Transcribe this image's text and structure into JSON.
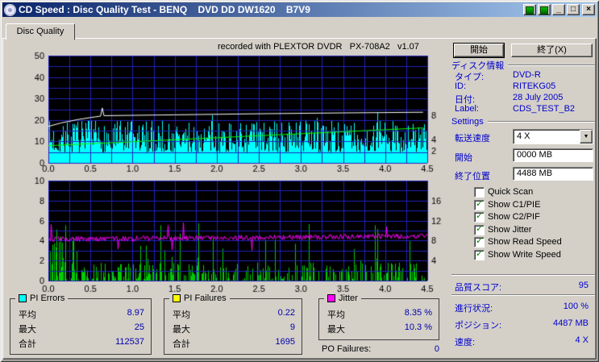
{
  "window": {
    "title": "CD Speed : Disc Quality Test - BENQ    DVD DD DW1620    B7V9",
    "minimize": "_",
    "maximize": "□",
    "close": "×"
  },
  "tab": {
    "label": "Disc Quality"
  },
  "recorded_note": "recorded with PLEXTOR DVDR   PX-708A2   v1.07",
  "right_panel": {
    "start_button": "開始",
    "exit_button": "終了(X)",
    "disc_info": {
      "header": "ディスク情報",
      "rows": [
        {
          "label": "タイプ:",
          "value": "DVD-R"
        },
        {
          "label": "ID:",
          "value": "RITEKG05"
        },
        {
          "label": "日付:",
          "value": "28 July 2005"
        },
        {
          "label": "Label:",
          "value": "CDS_TEST_B2"
        }
      ]
    },
    "settings": {
      "header": "Settings",
      "speed_label": "転送速度",
      "speed_value": "4 X",
      "start_label": "開始",
      "start_value": "0000 MB",
      "end_label": "終了位置",
      "end_value": "4488 MB",
      "checkboxes": [
        {
          "label": "Quick Scan",
          "checked": false
        },
        {
          "label": "Show C1/PIE",
          "checked": true
        },
        {
          "label": "Show C2/PIF",
          "checked": true
        },
        {
          "label": "Show Jitter",
          "checked": true
        },
        {
          "label": "Show Read Speed",
          "checked": true
        },
        {
          "label": "Show Write Speed",
          "checked": true
        }
      ]
    },
    "score": {
      "label": "品質スコア:",
      "value": "95"
    },
    "status": [
      {
        "label": "進行状況:",
        "value": "100 %"
      },
      {
        "label": "ポジション:",
        "value": "4487 MB"
      },
      {
        "label": "速度:",
        "value": "4 X"
      }
    ]
  },
  "legend": [
    {
      "title": "PI Errors",
      "swatch": "#00ffff",
      "rows": [
        {
          "label": "平均",
          "value": "8.97"
        },
        {
          "label": "最大",
          "value": "25"
        },
        {
          "label": "合計",
          "value": "112537"
        }
      ]
    },
    {
      "title": "PI Failures",
      "swatch": "#ffff00",
      "rows": [
        {
          "label": "平均",
          "value": "0.22"
        },
        {
          "label": "最大",
          "value": "9"
        },
        {
          "label": "合計",
          "value": "1695"
        }
      ]
    },
    {
      "title": "Jitter",
      "swatch": "#ff00ff",
      "rows": [
        {
          "label": "平均",
          "value": "8.35 %"
        },
        {
          "label": "最大",
          "value": "10.3 %"
        }
      ]
    }
  ],
  "po_failures": {
    "label": "PO Failures:",
    "value": "0"
  },
  "chart_data": [
    {
      "type": "area",
      "name": "pi-errors-and-speed",
      "x_range": [
        0,
        4.5
      ],
      "x_ticks": [
        "0.0",
        "0.5",
        "1.0",
        "1.5",
        "2.0",
        "2.5",
        "3.0",
        "3.5",
        "4.0",
        "4.5"
      ],
      "y_left": {
        "min": 0,
        "max": 50,
        "ticks": [
          0,
          10,
          20,
          30,
          40,
          50
        ]
      },
      "y_right_labels": [
        {
          "label": "8",
          "at": 22
        },
        {
          "label": "4",
          "at": 11
        },
        {
          "label": "2",
          "at": 5.5
        }
      ],
      "grid": {
        "x_step": 0.25,
        "y_step": 5,
        "color": "#2222bb"
      },
      "series": [
        {
          "name": "PI Errors",
          "color": "#00ffff",
          "style": "area-noise",
          "seed": 7,
          "base": 5,
          "amp": 15,
          "spike_p": 0.06,
          "spike_amp": 6,
          "clip": 25,
          "stats": {
            "average": 8.97,
            "maximum": 25,
            "total": 112537
          }
        },
        {
          "name": "Write Speed",
          "color": "#ffffff",
          "style": "line",
          "points": [
            [
              0,
              17
            ],
            [
              0.15,
              18.6
            ],
            [
              0.35,
              20.2
            ],
            [
              0.55,
              21.4
            ],
            [
              0.62,
              21.8
            ],
            [
              0.64,
              25.6
            ],
            [
              0.66,
              22
            ],
            [
              1.5,
              22.4
            ],
            [
              2.5,
              22.9
            ],
            [
              3.5,
              23.3
            ],
            [
              4.45,
              23.6
            ]
          ]
        },
        {
          "name": "Read Speed",
          "color": "#00ff00",
          "style": "line",
          "points": [
            [
              0,
              8
            ],
            [
              4.45,
              16.3
            ]
          ]
        }
      ]
    },
    {
      "type": "line",
      "name": "pi-failures-and-jitter",
      "x_range": [
        0,
        4.5
      ],
      "x_ticks": [
        "0.0",
        "0.5",
        "1.0",
        "1.5",
        "2.0",
        "2.5",
        "3.0",
        "3.5",
        "4.0",
        "4.5"
      ],
      "y_left": {
        "min": 0,
        "max": 10,
        "ticks": [
          0,
          2,
          4,
          6,
          8,
          10
        ]
      },
      "y_right_labels": [
        {
          "label": "16",
          "at": 8
        },
        {
          "label": "12",
          "at": 6
        },
        {
          "label": "8",
          "at": 4
        },
        {
          "label": "4",
          "at": 2
        }
      ],
      "grid": {
        "x_step": 0.25,
        "y_step": 1,
        "color": "#2222bb"
      },
      "series": [
        {
          "name": "PI Failures",
          "color": "#00cc00",
          "style": "spikes",
          "seed": 11,
          "p_small": 0.45,
          "h_small": 1.8,
          "p_big": 0.05,
          "h_big": 4,
          "early_x": 0.35,
          "early_p": 0.5,
          "early_h": 6,
          "clip": 9,
          "stats": {
            "average": 0.22,
            "maximum": 9,
            "total": 1695
          }
        },
        {
          "name": "Jitter",
          "color": "#ff00ff",
          "style": "noisy-line",
          "seed": 13,
          "base_start": 4.15,
          "base_end": 4.45,
          "noise": 0.5,
          "spike_p": 0.03,
          "spike_amp": 1.6,
          "stats": {
            "average": "8.35 %",
            "maximum": "10.3 %"
          }
        }
      ]
    }
  ]
}
